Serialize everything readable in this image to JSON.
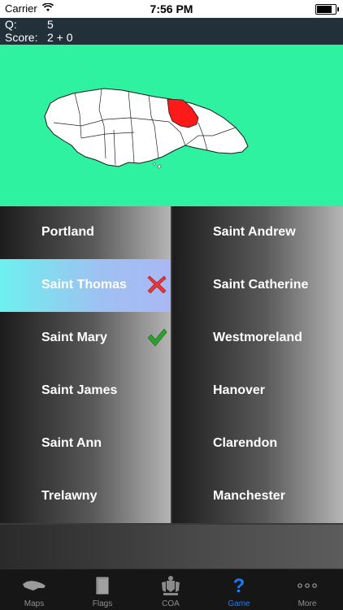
{
  "status_bar": {
    "carrier": "Carrier",
    "time": "7:56 PM",
    "battery_level": 0.9
  },
  "score": {
    "q_label": "Q:",
    "q_value": "5",
    "score_label": "Score:",
    "score_value": "2 + 0"
  },
  "map": {
    "background": "#2ef2a0",
    "highlight_color": "#ff1a1a"
  },
  "answers": {
    "left": [
      {
        "label": "Portland",
        "state": "normal"
      },
      {
        "label": "Saint Thomas",
        "state": "selected-wrong",
        "mark": "x-icon"
      },
      {
        "label": "Saint Mary",
        "state": "correct",
        "mark": "check-icon"
      },
      {
        "label": "Saint James",
        "state": "normal"
      },
      {
        "label": "Saint Ann",
        "state": "normal"
      },
      {
        "label": "Trelawny",
        "state": "normal"
      }
    ],
    "right": [
      {
        "label": "Saint Andrew"
      },
      {
        "label": "Saint Catherine"
      },
      {
        "label": "Westmoreland"
      },
      {
        "label": "Hanover"
      },
      {
        "label": "Clarendon"
      },
      {
        "label": "Manchester"
      }
    ]
  },
  "tabs": [
    {
      "label": "Maps",
      "icon": "map-icon",
      "active": false
    },
    {
      "label": "Flags",
      "icon": "flag-icon",
      "active": false
    },
    {
      "label": "COA",
      "icon": "coat-of-arms-icon",
      "active": false
    },
    {
      "label": "Game",
      "icon": "question-icon",
      "active": true
    },
    {
      "label": "More",
      "icon": "more-icon",
      "active": false
    }
  ],
  "colors": {
    "accent": "#1a7cf0",
    "wrong": "#e03a3a",
    "correct": "#2e9e2e"
  }
}
